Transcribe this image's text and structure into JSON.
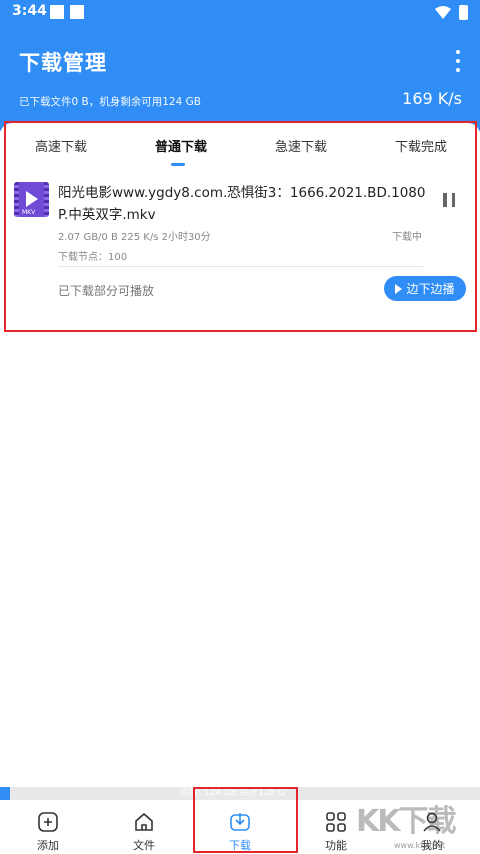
{
  "status_bar": {
    "time": "3:44"
  },
  "header": {
    "title": "下载管理",
    "storage_info": "已下载文件0 B，机身剩余可用124 GB",
    "speed": "169 K/s"
  },
  "tabs": [
    {
      "label": "高速下载"
    },
    {
      "label": "普通下载",
      "active": true
    },
    {
      "label": "急速下载"
    },
    {
      "label": "下载完成"
    }
  ],
  "download_item": {
    "thumb_label": "MKV",
    "file_name": "阳光电影www.ygdy8.com.恐惧街3：1666.2021.BD.1080P.中英双字.mkv",
    "meta": "2.07 GB/0 B  225 K/s  2小时30分",
    "status": "下载中",
    "nodes": "下载节点：100",
    "partial_play": "已下载部分可播放",
    "play_button": "边下边播"
  },
  "storage_bar": {
    "text": "可用: 124 GB 共计128 G",
    "used_fraction": 0.02
  },
  "bottom_nav": [
    {
      "label": "添加",
      "icon": "add-icon"
    },
    {
      "label": "文件",
      "icon": "home-icon"
    },
    {
      "label": "下载",
      "icon": "download-icon",
      "active": true
    },
    {
      "label": "功能",
      "icon": "grid-icon"
    },
    {
      "label": "我的",
      "icon": "user-icon"
    }
  ],
  "watermark": {
    "text": "KK下载",
    "url": "www.kkx.net"
  },
  "colors": {
    "primary": "#2f8df5",
    "highlight": "#e2262b",
    "thumb": "#6f4bd6"
  }
}
